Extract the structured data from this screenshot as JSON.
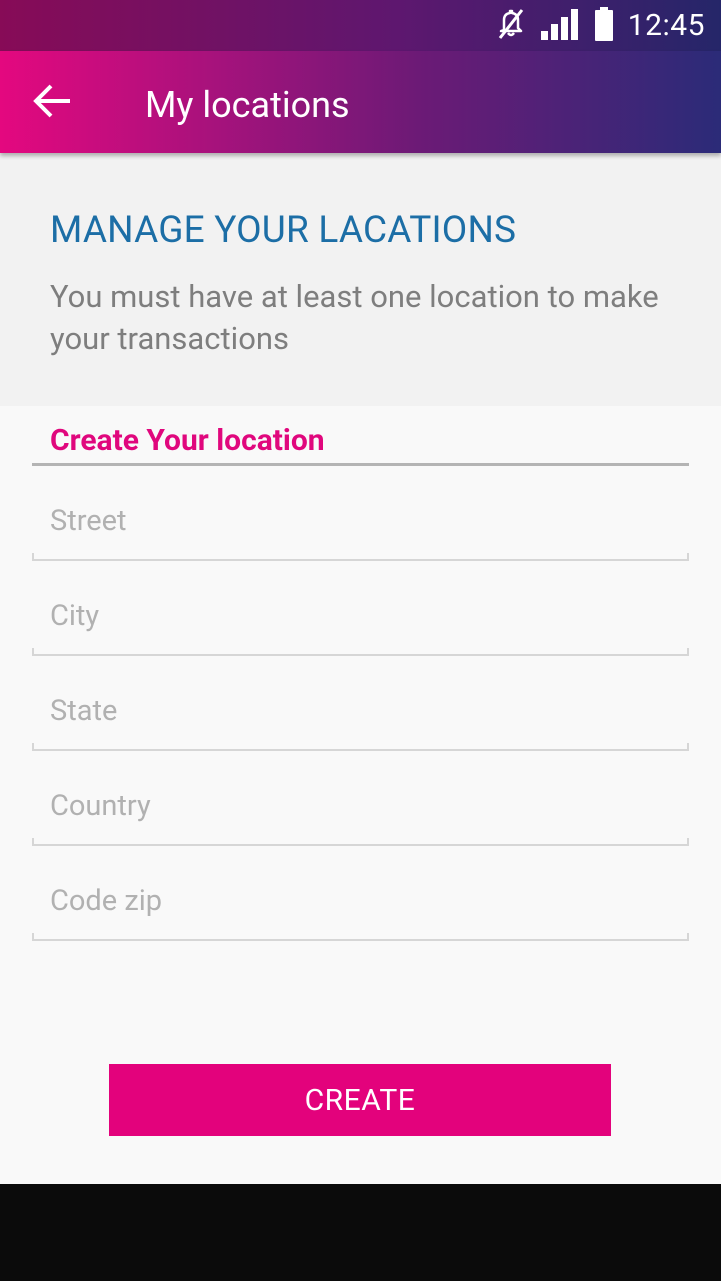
{
  "status_bar": {
    "time": "12:45",
    "icons": [
      "mute-icon",
      "signal-icon",
      "battery-icon"
    ]
  },
  "app_bar": {
    "back_icon": "arrow-back-icon",
    "title": "My locations"
  },
  "header": {
    "title": "MANAGE YOUR LACATIONS",
    "subtitle": "You must have at least one location to make your transactions"
  },
  "form": {
    "heading": "Create Your location",
    "fields": [
      {
        "placeholder": "Street",
        "value": ""
      },
      {
        "placeholder": "City",
        "value": ""
      },
      {
        "placeholder": "State",
        "value": ""
      },
      {
        "placeholder": "Country",
        "value": ""
      },
      {
        "placeholder": "Code zip",
        "value": ""
      }
    ],
    "submit_label": "CREATE"
  },
  "colors": {
    "accent": "#e3027c",
    "title_blue": "#1c6ea6",
    "app_bar_start": "#e4087f",
    "app_bar_end": "#2b2b78"
  }
}
